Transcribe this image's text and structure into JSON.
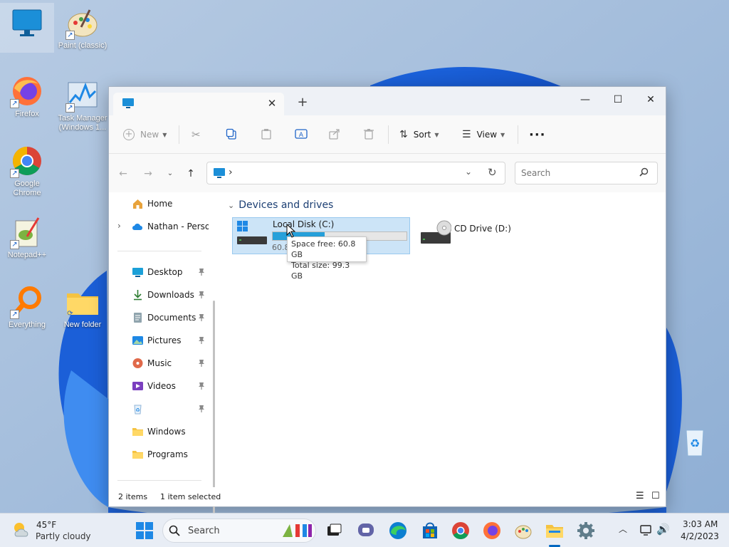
{
  "desktop": {
    "icons": [
      {
        "label": "",
        "kind": "this-pc"
      },
      {
        "label": "Paint (classic)",
        "kind": "paint"
      },
      {
        "label": "Firefox",
        "kind": "firefox"
      },
      {
        "label": "Task Manager (Windows 1...",
        "kind": "task-manager"
      },
      {
        "label": "Google Chrome",
        "kind": "chrome"
      },
      {
        "label": "Notepad++",
        "kind": "notepad-plus-plus"
      },
      {
        "label": "Everything",
        "kind": "everything"
      },
      {
        "label": "New folder",
        "kind": "folder"
      },
      {
        "label": "",
        "kind": "recycle-bin"
      }
    ]
  },
  "explorer": {
    "tab_title": "",
    "tab_close": "✕",
    "new_tab": "+",
    "window_controls": {
      "minimize": "—",
      "maximize": "☐",
      "close": "✕"
    },
    "toolbar": {
      "new_label": "New",
      "sort_label": "Sort",
      "view_label": "View",
      "more_label": "···"
    },
    "address": {
      "separator": "›",
      "search_placeholder": "Search"
    },
    "nav": {
      "home": "Home",
      "onedrive": "Nathan - Personal",
      "quick": [
        {
          "label": "Desktop",
          "icon": "desktop-icon"
        },
        {
          "label": "Downloads",
          "icon": "downloads-icon"
        },
        {
          "label": "Documents",
          "icon": "documents-icon"
        },
        {
          "label": "Pictures",
          "icon": "pictures-icon"
        },
        {
          "label": "Music",
          "icon": "music-icon"
        },
        {
          "label": "Videos",
          "icon": "videos-icon"
        },
        {
          "label": "",
          "icon": "recycle-bin-icon"
        },
        {
          "label": "Windows",
          "icon": "folder-icon"
        },
        {
          "label": "Programs",
          "icon": "folder-icon"
        }
      ]
    },
    "content": {
      "group_header": "Devices and drives",
      "drives": [
        {
          "name": "Local Disk (C:)",
          "sub": "60.8",
          "used_fraction": 0.39
        },
        {
          "name": "CD Drive (D:)"
        }
      ],
      "tooltip": {
        "line1": "Space free: 60.8 GB",
        "line2": "Total size: 99.3 GB"
      }
    },
    "status": {
      "items": "2 items",
      "selected": "1 item selected"
    }
  },
  "taskbar": {
    "weather_temp": "45°F",
    "weather_desc": "Partly cloudy",
    "search_label": "Search",
    "time": "3:03 AM",
    "date": "4/2/2023",
    "tray_chevron": "^"
  },
  "colors": {
    "accent": "#0067c0",
    "selection": "#cce4f7",
    "drive_fill": "#26a0da"
  }
}
